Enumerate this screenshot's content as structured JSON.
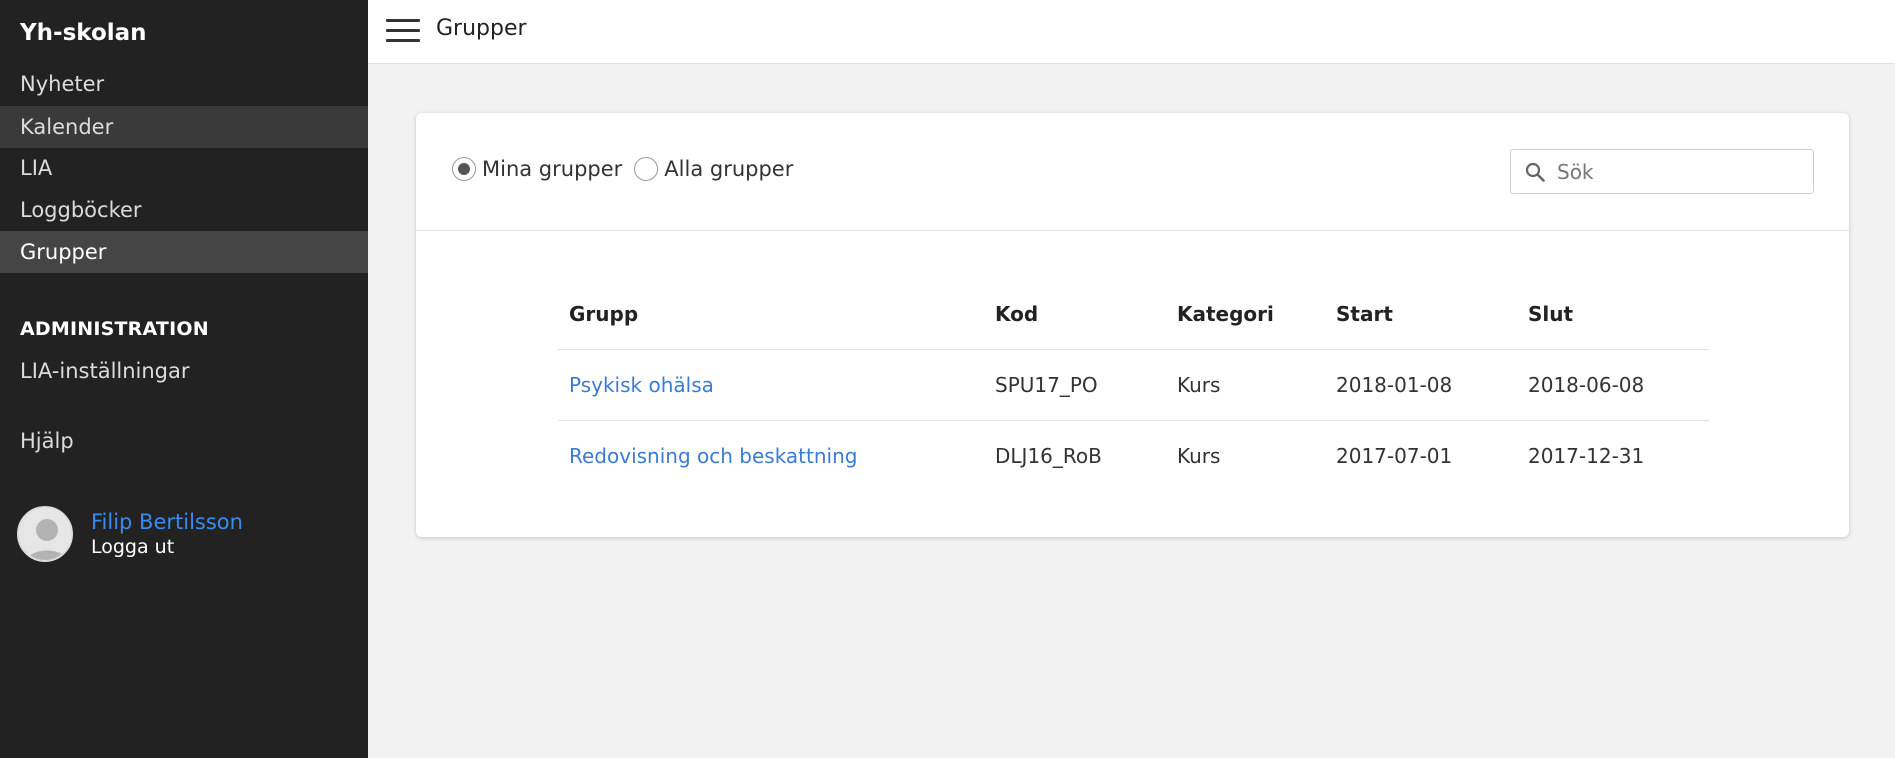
{
  "sidebar": {
    "brand": "Yh-skolan",
    "items": [
      {
        "label": "Nyheter"
      },
      {
        "label": "Kalender"
      },
      {
        "label": "LIA"
      },
      {
        "label": "Loggböcker"
      },
      {
        "label": "Grupper"
      }
    ],
    "admin_title": "ADMINISTRATION",
    "admin_items": [
      {
        "label": "LIA-inställningar"
      }
    ],
    "help": "Hjälp",
    "user": {
      "name": "Filip Bertilsson",
      "logout": "Logga ut"
    }
  },
  "header": {
    "title": "Grupper"
  },
  "filters": {
    "mine": "Mina grupper",
    "all": "Alla grupper",
    "selected": "Mina grupper"
  },
  "search": {
    "placeholder": "Sök",
    "value": ""
  },
  "table": {
    "headers": [
      "Grupp",
      "Kod",
      "Kategori",
      "Start",
      "Slut"
    ],
    "rows": [
      [
        "Psykisk ohälsa",
        "SPU17_PO",
        "Kurs",
        "2018-01-08",
        "2018-06-08"
      ],
      [
        "Redovisning och beskattning",
        "DLJ16_RoB",
        "Kurs",
        "2017-07-01",
        "2017-12-31"
      ]
    ]
  },
  "colors": {
    "sidebar_bg": "#222222",
    "link": "#3a7bd5",
    "user_link": "#3a8bf0",
    "page_bg": "#f2f2f2"
  },
  "icons": {
    "menu": "hamburger-icon",
    "search": "search-icon",
    "avatar": "user-avatar"
  }
}
